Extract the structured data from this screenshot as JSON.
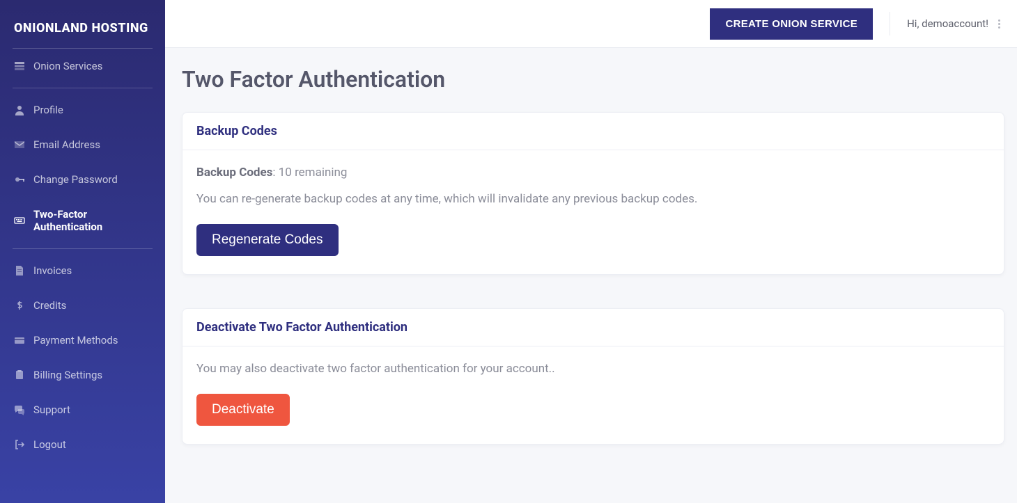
{
  "brand": "ONIONLAND HOSTING",
  "sidebar": {
    "items": [
      {
        "label": "Onion Services",
        "icon": "layers-icon",
        "active": false
      },
      {
        "label": "Profile",
        "icon": "user-icon",
        "active": false
      },
      {
        "label": "Email Address",
        "icon": "email-icon",
        "active": false
      },
      {
        "label": "Change Password",
        "icon": "key-icon",
        "active": false
      },
      {
        "label": "Two-Factor Authentication",
        "icon": "keyboard-icon",
        "active": true
      },
      {
        "label": "Invoices",
        "icon": "invoice-icon",
        "active": false
      },
      {
        "label": "Credits",
        "icon": "dollar-icon",
        "active": false
      },
      {
        "label": "Payment Methods",
        "icon": "card-icon",
        "active": false
      },
      {
        "label": "Billing Settings",
        "icon": "clipboard-icon",
        "active": false
      },
      {
        "label": "Support",
        "icon": "chat-icon",
        "active": false
      },
      {
        "label": "Logout",
        "icon": "logout-icon",
        "active": false
      }
    ]
  },
  "topbar": {
    "create_label": "CREATE ONION SERVICE",
    "greeting": "Hi, demoaccount!"
  },
  "page": {
    "title": "Two Factor Authentication"
  },
  "backup": {
    "card_title": "Backup Codes",
    "label": "Backup Codes",
    "remaining_text": ": 10 remaining",
    "help": "You can re-generate backup codes at any time, which will invalidate any previous backup codes.",
    "button": "Regenerate Codes"
  },
  "deactivate": {
    "card_title": "Deactivate Two Factor Authentication",
    "help": "You may also deactivate two factor authentication for your account..",
    "button": "Deactivate"
  }
}
